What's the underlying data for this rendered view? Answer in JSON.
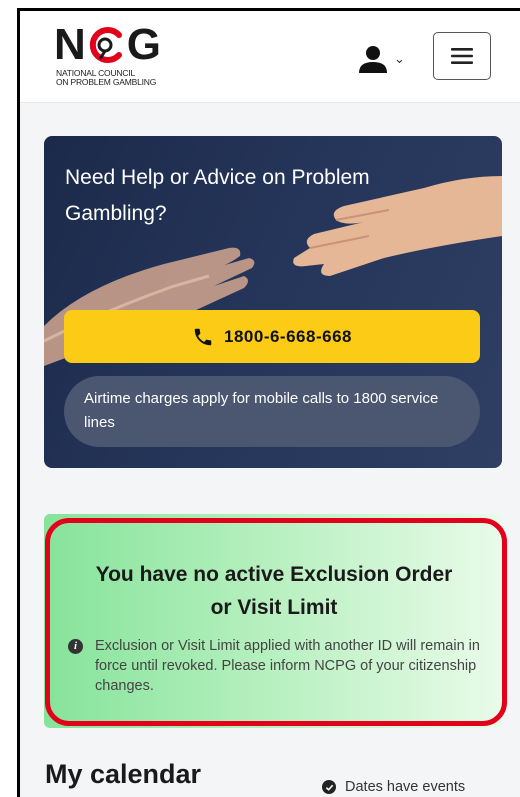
{
  "header": {
    "logo_text": {
      "n": "N",
      "g": "G"
    },
    "logo_sub_line1": "NATIONAL COUNCIL",
    "logo_sub_line2": "ON PROBLEM GAMBLING",
    "user_chevron": "⌄"
  },
  "help_card": {
    "title": "Need Help or Advice on Problem Gambling?",
    "phone": "1800-6-668-668",
    "note": "Airtime charges apply for mobile calls to 1800 service lines"
  },
  "exclusion": {
    "title": "You have no active Exclusion Order or Visit Limit",
    "info_icon": "i",
    "info_text": "Exclusion or Visit Limit applied with another ID will remain in force until revoked. Please inform NCPG of your citizenship changes."
  },
  "calendar": {
    "title": "My calendar",
    "legend": "Dates have events"
  },
  "icons": {
    "user": "user-icon",
    "menu": "hamburger-menu-icon",
    "phone": "phone-icon",
    "info": "info-icon",
    "check": "check-circle-icon"
  },
  "colors": {
    "help_bg": "#1b2a4a",
    "call_button": "#fccb15",
    "highlight_outline": "#e3001b",
    "logo_red": "#e3001b"
  }
}
